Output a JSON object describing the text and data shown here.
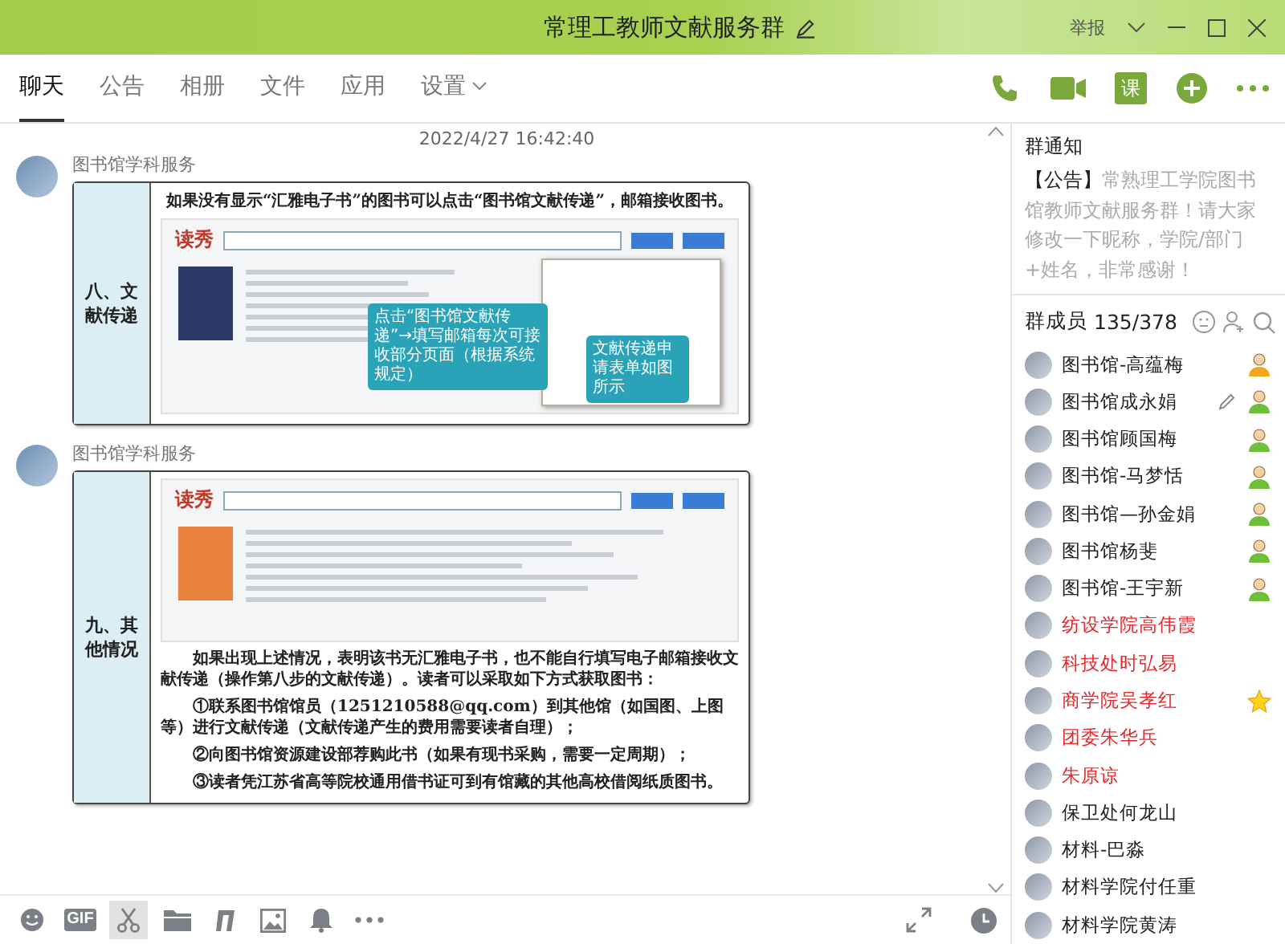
{
  "window": {
    "title": "常理工教师文献服务群",
    "report": "举报"
  },
  "tabs": [
    {
      "label": "聊天",
      "selected": true,
      "has_menu": false
    },
    {
      "label": "公告",
      "selected": false,
      "has_menu": false
    },
    {
      "label": "相册",
      "selected": false,
      "has_menu": false
    },
    {
      "label": "文件",
      "selected": false,
      "has_menu": false
    },
    {
      "label": "应用",
      "selected": false,
      "has_menu": false
    },
    {
      "label": "设置",
      "selected": false,
      "has_menu": true
    }
  ],
  "header_actions": [
    {
      "kind": "phone"
    },
    {
      "kind": "video"
    },
    {
      "kind": "lesson",
      "label": "课"
    },
    {
      "kind": "add"
    },
    {
      "kind": "more"
    }
  ],
  "chat": {
    "timestamp": "2022/4/27 16:42:40",
    "messages": [
      {
        "sender": "图书馆学科服务",
        "image": {
          "side_label": "八、文献传递",
          "heading": "如果没有显示“汇雅电子书”的图书可以点击“图书馆文献传递”，邮箱接收图书。",
          "logo": "读秀",
          "callouts": [
            "点击“图书馆文献传递”→填写邮箱每次可接收部分页面（根据系统规定）",
            "文献传递申请表单如图所示"
          ]
        }
      },
      {
        "sender": "图书馆学科服务",
        "image": {
          "side_label": "九、其他情况",
          "logo": "读秀",
          "paragraphs": [
            "如果出现上述情况，表明该书无汇雅电子书，也不能自行填写电子邮箱接收文献传递（操作第八步的文献传递）。读者可以采取如下方式获取图书：",
            "①联系图书馆馆员（1251210588@qq.com）到其他馆（如国图、上图等）进行文献传递（文献传递产生的费用需要读者自理）；",
            "②向图书馆资源建设部荐购此书（如果有现书采购，需要一定周期）；",
            "③读者凭江苏省高等院校通用借书证可到有馆藏的其他高校借阅纸质图书。"
          ]
        }
      }
    ]
  },
  "composer_tools": [
    {
      "kind": "emoji",
      "selected": false
    },
    {
      "kind": "gif",
      "label": "GIF",
      "selected": false
    },
    {
      "kind": "scissors",
      "selected": true
    },
    {
      "kind": "folder",
      "selected": false
    },
    {
      "kind": "music",
      "selected": false
    },
    {
      "kind": "image",
      "selected": false
    },
    {
      "kind": "bell",
      "selected": false
    },
    {
      "kind": "more",
      "selected": false
    }
  ],
  "side_panel": {
    "notice_title": "群通知",
    "notice": {
      "tag": "【公告】",
      "text": "常熟理工学院图书馆教师文献服务群！请大家修改一下昵称，学院/部门+姓名，非常感谢！"
    },
    "members_title": "群成员",
    "members_count": "135/378",
    "members": [
      {
        "name": "图书馆-高蕴梅",
        "color": "#222222",
        "kind": "owner",
        "hovered": false
      },
      {
        "name": "图书馆成永娟",
        "color": "#222222",
        "kind": "admin",
        "hovered": true
      },
      {
        "name": "图书馆顾国梅",
        "color": "#222222",
        "kind": "admin",
        "hovered": false
      },
      {
        "name": "图书馆-马梦恬",
        "color": "#222222",
        "kind": "admin",
        "hovered": false
      },
      {
        "name": "图书馆—孙金娟",
        "color": "#222222",
        "kind": "admin",
        "hovered": false
      },
      {
        "name": "图书馆杨斐",
        "color": "#222222",
        "kind": "admin",
        "hovered": false
      },
      {
        "name": "图书馆-王宇新",
        "color": "#222222",
        "kind": "admin",
        "hovered": false
      },
      {
        "name": "纺设学院高伟霞",
        "color": "#e8262b",
        "kind": "member",
        "hovered": false
      },
      {
        "name": "科技处时弘易",
        "color": "#e8262b",
        "kind": "member",
        "hovered": false
      },
      {
        "name": "商学院吴孝红",
        "color": "#e8262b",
        "kind": "star",
        "hovered": false
      },
      {
        "name": "团委朱华兵",
        "color": "#e8262b",
        "kind": "member",
        "hovered": false
      },
      {
        "name": "朱原谅",
        "color": "#e8262b",
        "kind": "member",
        "hovered": false
      },
      {
        "name": "保卫处何龙山",
        "color": "#222222",
        "kind": "member",
        "hovered": false
      },
      {
        "name": "材料-巴淼",
        "color": "#222222",
        "kind": "member",
        "hovered": false
      },
      {
        "name": "材料学院付任重",
        "color": "#222222",
        "kind": "member",
        "hovered": false
      },
      {
        "name": "材料学院黄涛",
        "color": "#222222",
        "kind": "member",
        "hovered": false
      }
    ]
  }
}
